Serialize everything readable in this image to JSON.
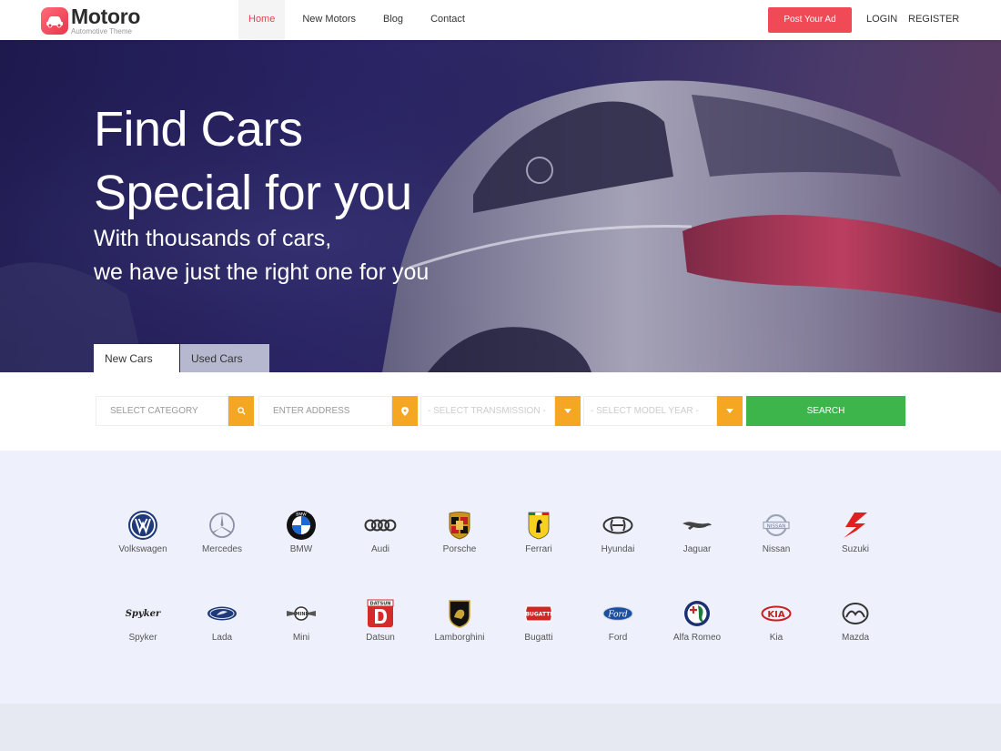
{
  "header": {
    "logo_name": "Motoro",
    "logo_tagline": "Automotive Theme",
    "nav": [
      "Home",
      "New Motors",
      "Blog",
      "Contact"
    ],
    "post_ad": "Post Your Ad",
    "login": "LOGIN",
    "register": "REGISTER"
  },
  "hero": {
    "title_line1": "Find Cars",
    "title_line2": "Special for you",
    "sub_line1": "With thousands of cars,",
    "sub_line2": "we have just the right one for you",
    "tabs": [
      "New Cars",
      "Used Cars"
    ]
  },
  "search": {
    "category": "SELECT CATEGORY",
    "address": "ENTER ADDRESS",
    "transmission": "- SELECT TRANSMISSION -",
    "model_year": "- SELECT MODEL YEAR -",
    "button": "SEARCH"
  },
  "brands": [
    "Volkswagen",
    "Mercedes",
    "BMW",
    "Audi",
    "Porsche",
    "Ferrari",
    "Hyundai",
    "Jaguar",
    "Nissan",
    "Suzuki",
    "Spyker",
    "Lada",
    "Mini",
    "Datsun",
    "Lamborghini",
    "Bugatti",
    "Ford",
    "Alfa Romeo",
    "Kia",
    "Mazda"
  ],
  "brand_logo_text": {
    "bmw": "BMW",
    "nissan": "NISSAN",
    "spyker": "Spyker",
    "mini": "MINI",
    "datsun": "DATSUN",
    "bugatti": "BUGATTI",
    "ford": "Ford",
    "kia": "KIA"
  },
  "colors": {
    "accent": "#ef4a56",
    "orange": "#f5a623",
    "green": "#3db54a"
  }
}
